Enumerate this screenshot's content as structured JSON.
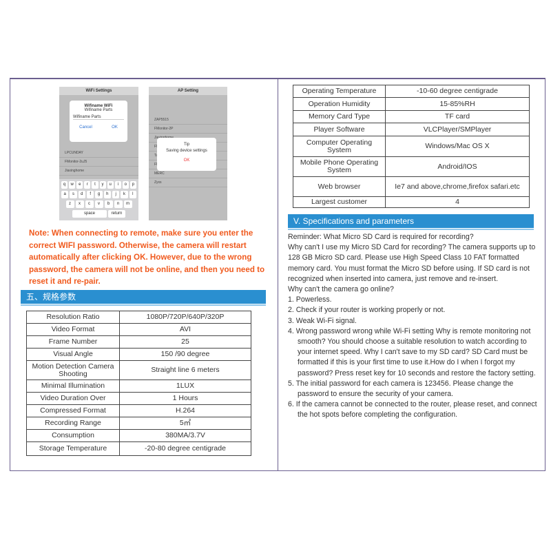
{
  "phones": {
    "left": {
      "title": "WiFi Settings",
      "dialog_title": "Wifiname WiFi",
      "dialog_sub": "Wifiname Parts",
      "field": "Wifiname Parts",
      "cancel": "Cancel",
      "ok": "OK",
      "networks": [
        "LPCUNDAY",
        "FMonitor-2uJ5",
        "Jiaxinghome"
      ],
      "keys": [
        [
          "q",
          "w",
          "e",
          "r",
          "t",
          "y",
          "u",
          "i",
          "o",
          "p"
        ],
        [
          "a",
          "s",
          "d",
          "f",
          "g",
          "h",
          "j",
          "k",
          "l"
        ],
        [
          "z",
          "x",
          "c",
          "v",
          "b",
          "n",
          "m"
        ]
      ],
      "space": "space",
      "return": "return"
    },
    "right": {
      "title": "AP Setting",
      "dialog_title": "Tip",
      "dialog_msg": "Saving device settings",
      "ok": "OK",
      "networks": [
        "ZAP5515",
        "FMonitor-2P",
        "Jiaxinghome",
        "FMonitor-2RP",
        "TaLinkZ_AP",
        "FMonitor-oP",
        "MERC",
        "Zyxs"
      ]
    }
  },
  "note": "Note: When connecting to remote, make sure you enter the correct WIFI password. Otherwise, the camera will restart automatically after clicking OK. However, due to the wrong password, the camera will not be online, and then you need to reset it and re-pair.",
  "left_header": "五、规格参数",
  "left_table": [
    [
      "Resolution Ratio",
      "1080P/720P/640P/320P"
    ],
    [
      "Video Format",
      "AVI"
    ],
    [
      "Frame Number",
      "25"
    ],
    [
      "Visual Angle",
      "150 /90 degree"
    ],
    [
      "Motion Detection Camera Shooting",
      "Straight line 6 meters"
    ],
    [
      "Minimal Illumination",
      "1LUX"
    ],
    [
      "Video Duration Over",
      "1 Hours"
    ],
    [
      "Compressed Format",
      "H.264"
    ],
    [
      "Recording Range",
      "5㎡"
    ],
    [
      "Consumption",
      "380MA/3.7V"
    ],
    [
      "Storage Temperature",
      "-20-80 degree centigrade"
    ]
  ],
  "right_table": [
    [
      "Operating Temperature",
      "-10-60 degree centigrade"
    ],
    [
      "Operation Humidity",
      "15-85%RH"
    ],
    [
      "Memory Card Type",
      "TF card"
    ],
    [
      "Player Software",
      "VLCPlayer/SMPlayer"
    ],
    [
      "Computer Operating System",
      "Windows/Mac OS X"
    ],
    [
      "Mobile Phone Operating System",
      "Android/IOS"
    ],
    [
      "Web browser",
      "Ie7 and above,chrome,firefox safari.etc"
    ],
    [
      "Largest customer",
      "4"
    ]
  ],
  "right_header": "V. Specifications and parameters",
  "body": {
    "intro": [
      "Reminder: What Micro SD Card is required for recording?",
      "Why can't I use my Micro SD Card for recording? The camera supports up to 128 GB Micro SD card. Please use High Speed Class 10 FAT formatted memory card. You must format the Micro SD before using. If SD card is not recognized when inserted into camera, just remove and re-insert.",
      "Why can't the camera go online?"
    ],
    "items": [
      "1. Powerless.",
      "2. Check if your router is working properly or not.",
      "3. Weak Wi-Fi signal.",
      "4. Wrong password wrong while Wi-Fi setting Why is remote monitoring not smooth? You should choose a suitable resolution to watch according to your internet speed. Why I can't save to my SD card? SD Card must be formatted if this is your first time to use it.How do I when I forgot my password? Press reset key for 10 seconds and restore the factory setting.",
      "5. The initial password for each camera is 123456. Please change the password to ensure the security of your camera.",
      "6. If the camera cannot be connected to the router, please reset, and connect the hot spots before completing the configuration."
    ]
  },
  "colors": {
    "note": "#f05a1e",
    "header": "#2a8fd0",
    "frame": "#6b5f8f"
  }
}
